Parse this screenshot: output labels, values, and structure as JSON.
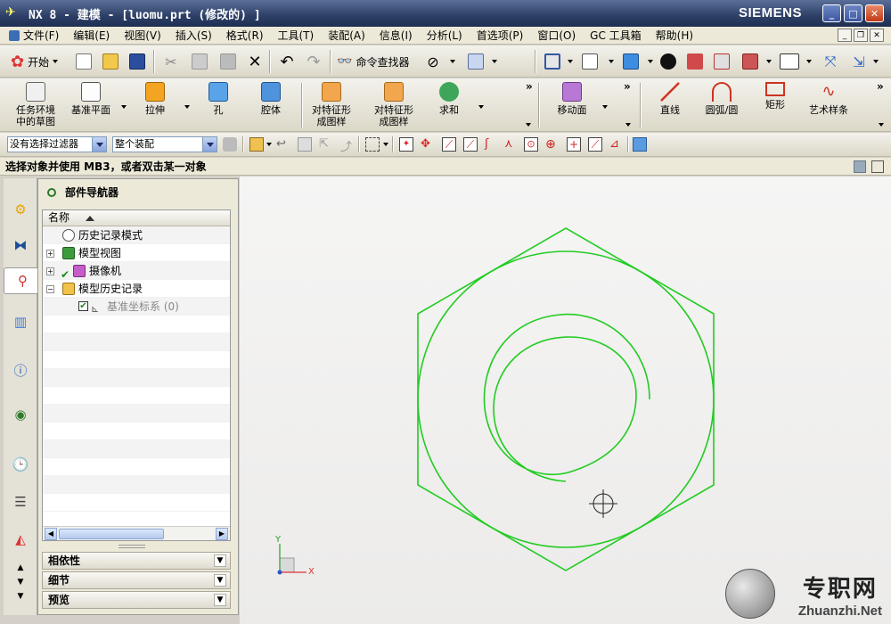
{
  "window": {
    "title": "NX 8 - 建模 - [luomu.prt  (修改的) ]",
    "brand": "SIEMENS",
    "min": "_",
    "max": "□",
    "close": "✕"
  },
  "menu": [
    "文件(F)",
    "编辑(E)",
    "视图(V)",
    "插入(S)",
    "格式(R)",
    "工具(T)",
    "装配(A)",
    "信息(I)",
    "分析(L)",
    "首选项(P)",
    "窗口(O)",
    "GC 工具箱",
    "帮助(H)"
  ],
  "toolbar1": {
    "start_label": "开始",
    "command_finder_label": "命令查找器"
  },
  "toolbar2": {
    "buttons": [
      "任务环境\n中的草图",
      "基准平面",
      "拉伸",
      "孔",
      "腔体",
      "对特征形\n成图样",
      "对特征形\n成图样",
      "求和",
      "移动面",
      "直线",
      "圆弧/圆",
      "矩形",
      "艺术样条"
    ],
    "overflow": "»"
  },
  "toolbar3": {
    "filter_value": "没有选择过滤器",
    "scope_value": "整个装配"
  },
  "cue_line": "选择对象并使用 MB3，或者双击某一对象",
  "navigator": {
    "title": "部件导航器",
    "column_name": "名称",
    "rows": [
      {
        "label": "历史记录模式"
      },
      {
        "label": "模型视图"
      },
      {
        "label": "摄像机"
      },
      {
        "label": "模型历史记录"
      },
      {
        "label": "基准坐标系 (0)"
      }
    ],
    "sections": [
      "相依性",
      "细节",
      "预览"
    ]
  },
  "graphics": {
    "triad_x": "X",
    "triad_y": "Y",
    "curve_color": "#22cc22"
  },
  "watermark": {
    "cn": "专职网",
    "en": "Zhuanzhi.Net"
  }
}
